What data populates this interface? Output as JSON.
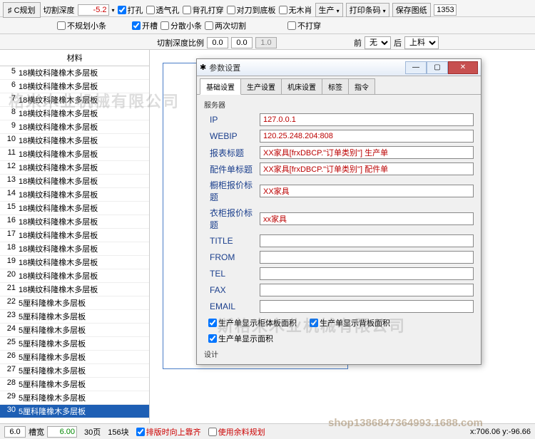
{
  "toolbar": {
    "cplan_btn": "C规划",
    "cut_depth_label": "切割深度",
    "cut_depth_value": "-5.2",
    "drill": "打孔",
    "vent": "透气孔",
    "back_drill": "背孔打穿",
    "knife_bottom": "对刀到底板",
    "no_wood": "无木肖",
    "no_plan_small": "不规划小条",
    "slot": "开槽",
    "scatter_small": "分散小条",
    "cut_twice": "两次切割",
    "no_through": "不打穿",
    "produce_btn": "生产",
    "print_barcode_btn": "打印条码",
    "save_paper_btn": "保存图纸",
    "paper_num": "1353",
    "cut_ratio_label": "切割深度比例",
    "ratio_a": "0.0",
    "ratio_b": "0.0",
    "ratio_c": "1.0",
    "front_label": "前",
    "front_value": "无",
    "back_label": "后",
    "back_value": "上料"
  },
  "sidebar": {
    "header": "材料",
    "items": [
      {
        "n": "5",
        "name": "18横纹科隆橡木多层板"
      },
      {
        "n": "6",
        "name": "18横纹科隆橡木多层板"
      },
      {
        "n": "7",
        "name": "18横纹科隆橡木多层板"
      },
      {
        "n": "8",
        "name": "18横纹科隆橡木多层板"
      },
      {
        "n": "9",
        "name": "18横纹科隆橡木多层板"
      },
      {
        "n": "10",
        "name": "18横纹科隆橡木多层板"
      },
      {
        "n": "11",
        "name": "18横纹科隆橡木多层板"
      },
      {
        "n": "12",
        "name": "18横纹科隆橡木多层板"
      },
      {
        "n": "13",
        "name": "18横纹科隆橡木多层板"
      },
      {
        "n": "14",
        "name": "18横纹科隆橡木多层板"
      },
      {
        "n": "15",
        "name": "18横纹科隆橡木多层板"
      },
      {
        "n": "16",
        "name": "18横纹科隆橡木多层板"
      },
      {
        "n": "17",
        "name": "18横纹科隆橡木多层板"
      },
      {
        "n": "18",
        "name": "18横纹科隆橡木多层板"
      },
      {
        "n": "19",
        "name": "18横纹科隆橡木多层板"
      },
      {
        "n": "20",
        "name": "18横纹科隆橡木多层板"
      },
      {
        "n": "21",
        "name": "18横纹科隆橡木多层板"
      },
      {
        "n": "22",
        "name": "5厘科隆橡木多层板"
      },
      {
        "n": "23",
        "name": "5厘科隆橡木多层板"
      },
      {
        "n": "24",
        "name": "5厘科隆橡木多层板"
      },
      {
        "n": "25",
        "name": "5厘科隆橡木多层板"
      },
      {
        "n": "26",
        "name": "5厘科隆橡木多层板"
      },
      {
        "n": "27",
        "name": "5厘科隆橡木多层板"
      },
      {
        "n": "28",
        "name": "5厘科隆橡木多层板"
      },
      {
        "n": "29",
        "name": "5厘科隆橡木多层板"
      },
      {
        "n": "30",
        "name": "5厘科隆橡木多层板",
        "selected": true
      }
    ]
  },
  "dialog": {
    "title": "参数设置",
    "tabs": [
      "基础设置",
      "生产设置",
      "机床设置",
      "标签",
      "指令"
    ],
    "active_tab": 0,
    "server_label": "服务器",
    "fields": {
      "ip_label": "IP",
      "ip_value": "127.0.0.1",
      "webip_label": "WEBIP",
      "webip_value": "120.25.248.204:808",
      "report_title_label": "报表标题",
      "report_title_value": "XX家具[frxDBCP.\"订单类别\"] 生产单",
      "parts_title_label": "配件单标题",
      "parts_title_value": "XX家具[frxDBCP.\"订单类别\"] 配件单",
      "cabinet_quote_label": "橱柜报价标题",
      "cabinet_quote_value": "XX家具",
      "wardrobe_quote_label": "衣柜报价标题",
      "wardrobe_quote_value": "xx家具",
      "title_label": "TITLE",
      "title_value": "",
      "from_label": "FROM",
      "from_value": "",
      "tel_label": "TEL",
      "tel_value": "",
      "fax_label": "FAX",
      "fax_value": "",
      "email_label": "EMAIL",
      "email_value": ""
    },
    "chk_cabinet_area": "生产单显示柜体板面积",
    "chk_back_area": "生产单显示背板面积",
    "chk_face_area": "生产单显示面积",
    "design_label": "设计"
  },
  "status": {
    "val_a": "6.0",
    "slot_width_label": "槽宽",
    "slot_width_value": "6.00",
    "pages": "30页",
    "blocks": "156块",
    "align_top": "排版时向上靠齐",
    "use_remnant": "使用余料规划",
    "coords": "x:706.06 y:-96.66"
  },
  "watermarks": {
    "wm1": "格米木业机械有限公司",
    "wm2": "斯格米木业机械有限公司",
    "wm3": "shop1386847364993.1688.com"
  }
}
